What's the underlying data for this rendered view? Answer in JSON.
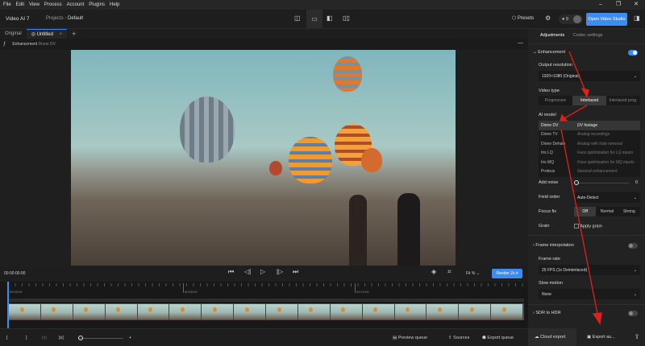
{
  "menu": [
    "File",
    "Edit",
    "View",
    "Process",
    "Account",
    "Plugins",
    "Help"
  ],
  "window_controls": [
    "minimize-icon",
    "restore-icon",
    "close-icon"
  ],
  "app": {
    "name": "Video AI",
    "version": "7"
  },
  "breadcrumb": {
    "parent": "Projects",
    "current": "Default"
  },
  "header": {
    "presets": "Presets",
    "credits": "9",
    "open_studio": "Open Video Studio"
  },
  "tabs": {
    "original": "Original",
    "active": "Untitled"
  },
  "enhancement_crumb": {
    "label": "Enhancement",
    "model": "Dione DV"
  },
  "controls": {
    "timecode": "00:00:00:00",
    "zoom": "Fit %",
    "render": "Render 2s"
  },
  "timeline": {
    "ticks": [
      "00:00:00",
      "00:05:00",
      "00:10:00"
    ]
  },
  "bottom": {
    "preview_queue": "Preview queue",
    "sources": "Sources",
    "export_queue": "Export queue"
  },
  "panel": {
    "tabs": [
      "Adjustments",
      "Codec settings"
    ],
    "enhancement": {
      "title": "Enhancement",
      "enabled": true,
      "output_resolution_label": "Output resolution",
      "output_resolution": "1920×1080 (Original)",
      "video_type_label": "Video type",
      "video_types": [
        "Progressive",
        "Interlaced",
        "Interlaced prog."
      ],
      "video_type_selected": "Interlaced",
      "ai_model_label": "AI model",
      "models": [
        {
          "name": "Dione DV",
          "desc": "DV footage"
        },
        {
          "name": "Dione TV",
          "desc": "Analog recordings"
        },
        {
          "name": "Dione Dehalo",
          "desc": "Analog with halo removal"
        },
        {
          "name": "Iris LQ",
          "desc": "Face optimization for LQ inputs"
        },
        {
          "name": "Iris MQ",
          "desc": "Face optimization for MQ inputs"
        },
        {
          "name": "Proteus",
          "desc": "General enhancement"
        }
      ],
      "model_selected": "Dione DV",
      "add_noise_label": "Add noise",
      "add_noise": "0",
      "field_order_label": "Field order",
      "field_order": "Auto-Detect",
      "focus_fix_label": "Focus fix",
      "focus_fix_options": [
        "Off",
        "Normal",
        "Strong"
      ],
      "focus_fix_selected": "Off",
      "grain_label": "Grain",
      "apply_grain": "Apply grain"
    },
    "frame_interpolation": {
      "title": "Frame interpolation",
      "enabled": false,
      "frame_rate_label": "Frame rate",
      "frame_rate": "25 FPS (1x Deinterlaced)",
      "slow_motion_label": "Slow motion",
      "slow_motion": "None"
    },
    "sdr_to_hdr": {
      "title": "SDR to HDR",
      "enabled": false
    },
    "cloud_export": "Cloud export",
    "export_as": "Export as...",
    "accent": "#3b8cf5"
  }
}
